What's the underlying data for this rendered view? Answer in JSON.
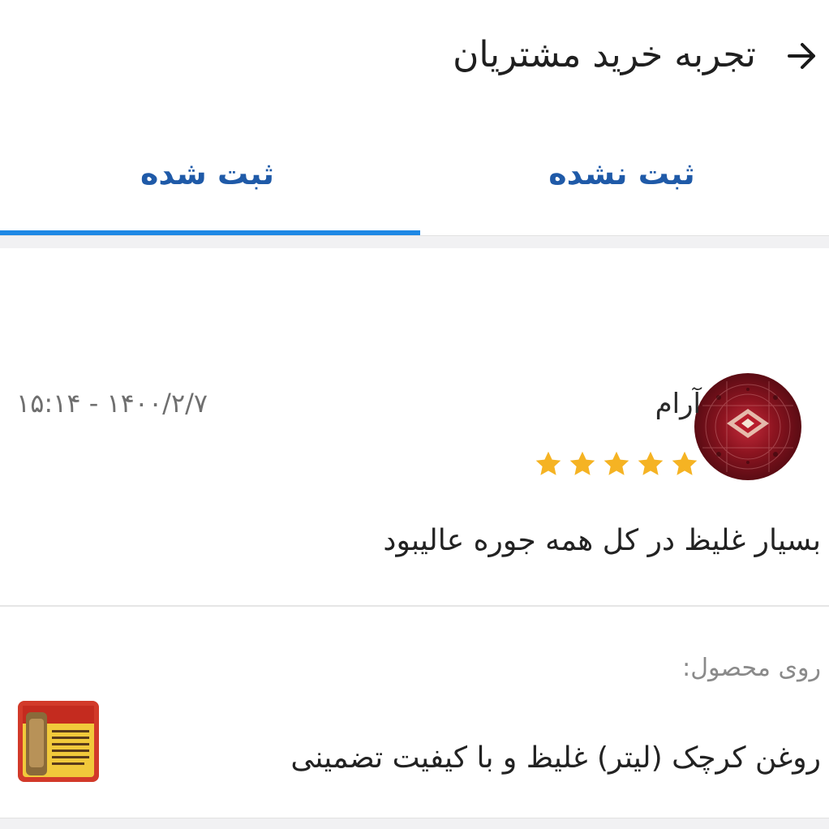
{
  "header": {
    "title": "تجربه خرید مشتریان",
    "back_icon": "arrow-right-icon"
  },
  "tabs": [
    {
      "label": "ثبت نشده",
      "active": false
    },
    {
      "label": "ثبت شده",
      "active": true
    }
  ],
  "colors": {
    "tab_text": "#1f5aa8",
    "tab_indicator": "#1e88e5",
    "star": "#f5b323"
  },
  "review": {
    "reviewer_name": "آرام",
    "date": "۱۵:۱۴ - ۱۴۰۰/۲/۷",
    "rating": 5,
    "max_rating": 5,
    "text": "بسیار غلیظ در کل همه جوره عالیبود"
  },
  "product": {
    "caption": "روی محصول:",
    "name": "روغن کرچک (لیتر) غلیظ و با کیفیت تضمینی"
  }
}
